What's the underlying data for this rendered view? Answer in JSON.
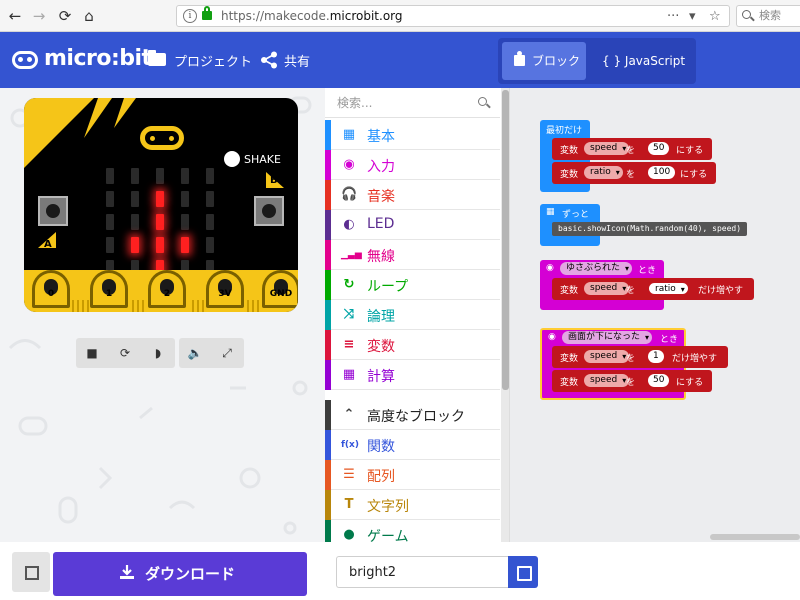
{
  "browser": {
    "url_prefix": "https://makecode.",
    "url_domain": "microbit.org",
    "search_placeholder": "検索",
    "more": "···"
  },
  "header": {
    "logo": "micro:bit",
    "projects_label": "プロジェクト",
    "share_label": "共有",
    "blocks_label": "ブロック",
    "javascript_label": "{ } JavaScript"
  },
  "simulator": {
    "shake_label": "SHAKE",
    "button_a": "A",
    "button_b": "B",
    "pins": [
      "0",
      "1",
      "2",
      "3V",
      "GND"
    ],
    "led_matrix": [
      [
        0,
        0,
        0,
        0,
        0
      ],
      [
        0,
        0,
        1,
        0,
        0
      ],
      [
        0,
        0,
        1,
        0,
        0
      ],
      [
        0,
        1,
        1,
        1,
        0
      ],
      [
        0,
        0,
        1,
        0,
        0
      ]
    ]
  },
  "toolbox": {
    "search_placeholder": "検索...",
    "categories": [
      {
        "label": "基本",
        "color": "#1e90ff",
        "icon": "▦"
      },
      {
        "label": "入力",
        "color": "#d400d4",
        "icon": "◉"
      },
      {
        "label": "音楽",
        "color": "#e63022",
        "icon": "🎧"
      },
      {
        "label": "LED",
        "color": "#5c2d91",
        "icon": "◐"
      },
      {
        "label": "無線",
        "color": "#e3008c",
        "icon": "▁▃▅"
      },
      {
        "label": "ループ",
        "color": "#00aa00",
        "icon": "↻"
      },
      {
        "label": "論理",
        "color": "#00a4a6",
        "icon": "⤨"
      },
      {
        "label": "変数",
        "color": "#dc143c",
        "icon": "≡"
      },
      {
        "label": "計算",
        "color": "#9400d3",
        "icon": "▦"
      },
      {
        "label": "高度なブロック",
        "color": "#3c3c3c",
        "icon": "⌃"
      },
      {
        "label": "関数",
        "color": "#3455db",
        "icon": "f(x)"
      },
      {
        "label": "配列",
        "color": "#e65722",
        "icon": "☰"
      },
      {
        "label": "文字列",
        "color": "#b8860b",
        "icon": "T"
      },
      {
        "label": "ゲーム",
        "color": "#007a4b",
        "icon": "●"
      }
    ]
  },
  "workspace": {
    "on_start": {
      "header": "最初だけ",
      "rows": [
        {
          "prefix": "変数",
          "var": "speed",
          "mid": "を",
          "value": "50",
          "suffix": "にする"
        },
        {
          "prefix": "変数",
          "var": "ratio",
          "mid": "を",
          "value": "100",
          "suffix": "にする"
        }
      ]
    },
    "forever": {
      "header": "ずっと",
      "code": "basic.showIcon(Math.random(40), speed)"
    },
    "on_shake": {
      "header": "ゆさぶられた",
      "header_suffix": "とき",
      "row": {
        "prefix": "変数",
        "var": "speed",
        "mid": "を",
        "value_var": "ratio",
        "suffix": "だけ増やす"
      }
    },
    "on_face_down": {
      "header": "画面が下になった",
      "header_suffix": "とき",
      "rows": [
        {
          "prefix": "変数",
          "var": "speed",
          "mid": "を",
          "value": "1",
          "suffix": "だけ増やす"
        },
        {
          "prefix": "変数",
          "var": "speed",
          "mid": "を",
          "value": "50",
          "suffix": "にする"
        }
      ]
    }
  },
  "footer": {
    "download_label": "ダウンロード",
    "project_name": "bright2"
  }
}
